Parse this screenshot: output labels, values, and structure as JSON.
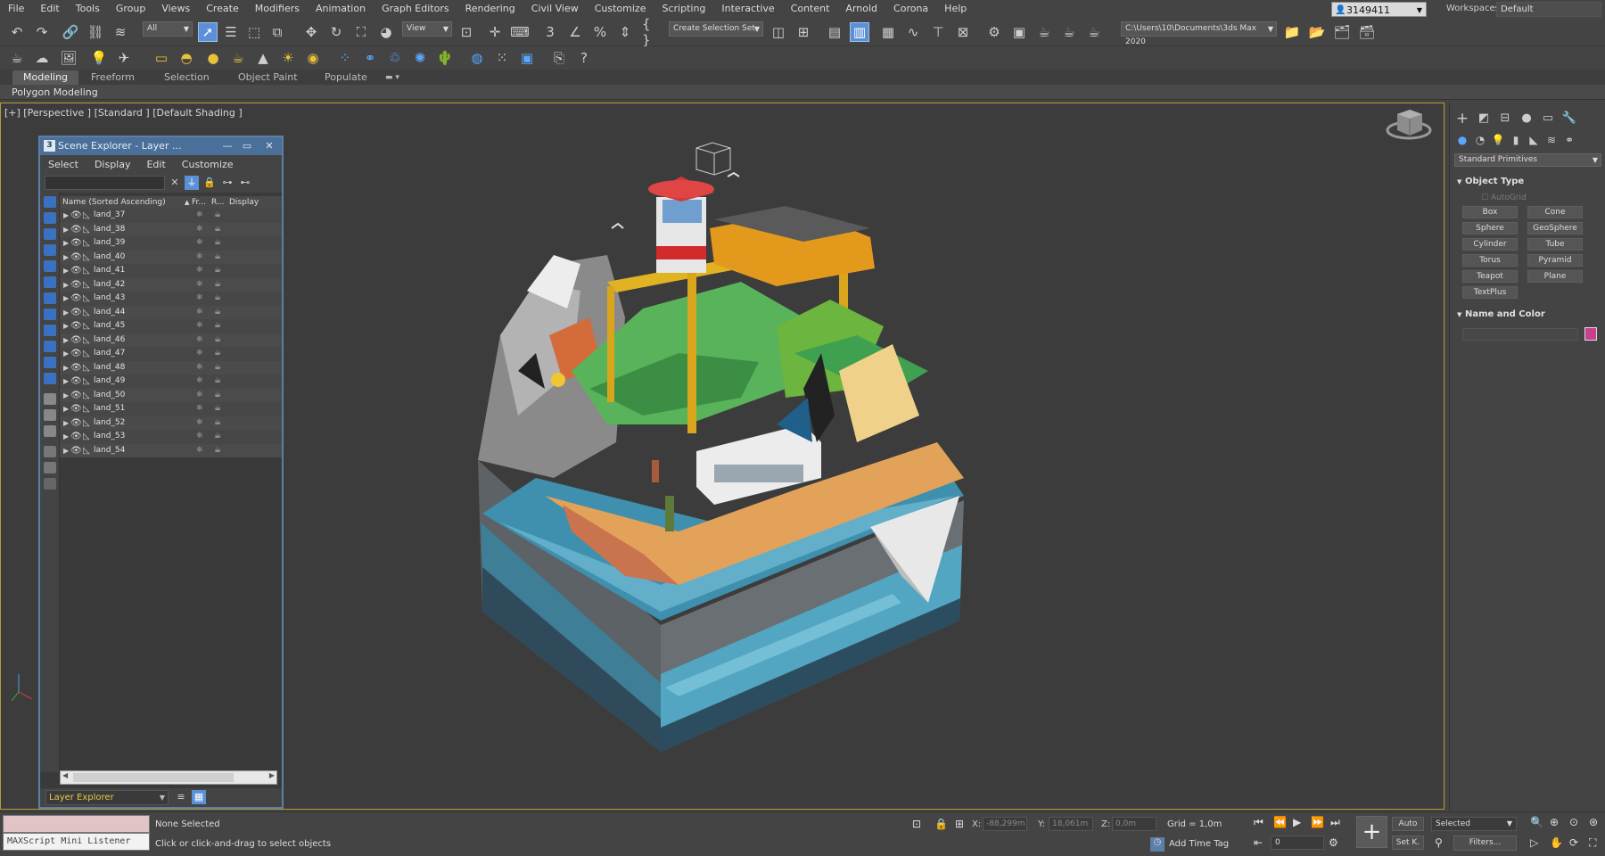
{
  "menu": [
    "File",
    "Edit",
    "Tools",
    "Group",
    "Views",
    "Create",
    "Modifiers",
    "Animation",
    "Graph Editors",
    "Rendering",
    "Civil View",
    "Customize",
    "Scripting",
    "Interactive",
    "Content",
    "Arnold",
    "Corona",
    "Help"
  ],
  "user": "3149411",
  "workspace": {
    "label": "Workspaces:",
    "value": "Default"
  },
  "toolbar": {
    "filter_dd": "All",
    "view_dd": "View",
    "selection_set_dd": "Create Selection Set",
    "project_path": "C:\\Users\\10\\Documents\\3ds Max 2020"
  },
  "ribbon": {
    "tabs": [
      "Modeling",
      "Freeform",
      "Selection",
      "Object Paint",
      "Populate"
    ],
    "active_tab": "Modeling",
    "panel_label": "Polygon Modeling"
  },
  "viewport": {
    "label": "[+] [Perspective ] [Standard ] [Default Shading ]"
  },
  "scene_explorer": {
    "title": "Scene Explorer - Layer ...",
    "menu": [
      "Select",
      "Display",
      "Edit",
      "Customize"
    ],
    "columns": [
      "Name (Sorted Ascending)",
      "Fr...",
      "R...",
      "Display"
    ],
    "rows": [
      "land_37",
      "land_38",
      "land_39",
      "land_40",
      "land_41",
      "land_42",
      "land_43",
      "land_44",
      "land_45",
      "land_46",
      "land_47",
      "land_48",
      "land_49",
      "land_50",
      "land_51",
      "land_52",
      "land_53",
      "land_54"
    ],
    "explorer_type": "Layer Explorer"
  },
  "command_panel": {
    "category_dd": "Standard Primitives",
    "object_type_title": "Object Type",
    "autogrid": "AutoGrid",
    "primitives": [
      "Box",
      "Cone",
      "Sphere",
      "GeoSphere",
      "Cylinder",
      "Tube",
      "Torus",
      "Pyramid",
      "Teapot",
      "Plane",
      "TextPlus"
    ],
    "name_color_title": "Name and Color",
    "swatch_color": "#c73f8d"
  },
  "status": {
    "maxscript_label": "MAXScript Mini Listener",
    "selection": "None Selected",
    "prompt": "Click or click-and-drag to select objects",
    "x_label": "X:",
    "x_value": "-88,299m",
    "y_label": "Y:",
    "y_value": "18,061m",
    "z_label": "Z:",
    "z_value": "0,0m",
    "grid": "Grid = 1,0m",
    "add_time_tag": "Add Time Tag",
    "auto_key": "Auto",
    "set_key": "Set K.",
    "selected_dd": "Selected",
    "filters": "Filters...",
    "frame": "0"
  }
}
